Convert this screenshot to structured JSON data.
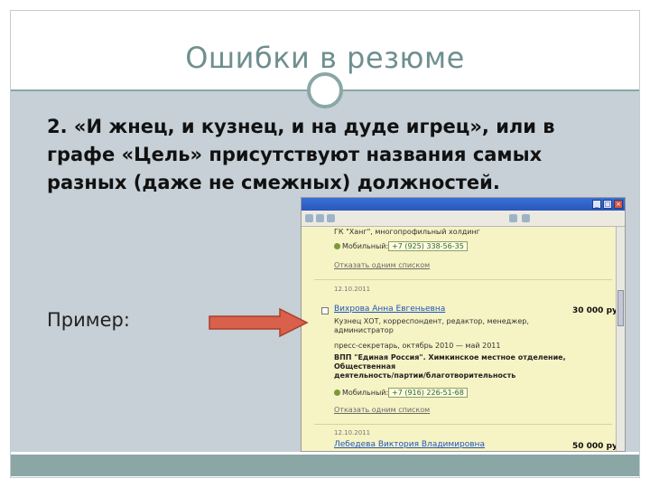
{
  "slide": {
    "title": "Ошибки в резюме",
    "paragraph": "2. «И жнец, и кузнец, и на дуде игрец», или в графе «Цель» присутствуют названия самых разных (даже не смежных) должностей.",
    "example_label": "Пример:",
    "colors": {
      "title": "#6f8f8f",
      "content_bg": "#c6d0d6",
      "accent": "#8aa7a6",
      "arrow": "#d9604a"
    }
  },
  "screenshot": {
    "entry0": {
      "org_line": "ГК \"Ханг\", многопрофильный холдинг",
      "phone_label": "Мобильный:",
      "phone": "+7 (925) 338-56-35",
      "send_link": "Отказать одним списком"
    },
    "entry1": {
      "date": "12.10.2011",
      "name": "Вихрова Анна Евгеньевна",
      "salary": "30 000 ру",
      "positions": "Кузнец ХОТ, корреспондент, редактор, менеджер,",
      "positions2": "администратор",
      "job": "пресс-секретарь, октябрь 2010 — май 2011",
      "org1": "ВПП \"Единая Россия\". Химкинское местное отделение,",
      "org2": "Общественная",
      "org3": "деятельность/партии/благотворительность",
      "phone_label": "Мобильный:",
      "phone": "+7 (916) 226-51-68",
      "send_link": "Отказать одним списком"
    },
    "entry2": {
      "date": "12.10.2011",
      "name": "Лебедева Виктория Владимировна",
      "salary": "50 000 ру"
    }
  }
}
